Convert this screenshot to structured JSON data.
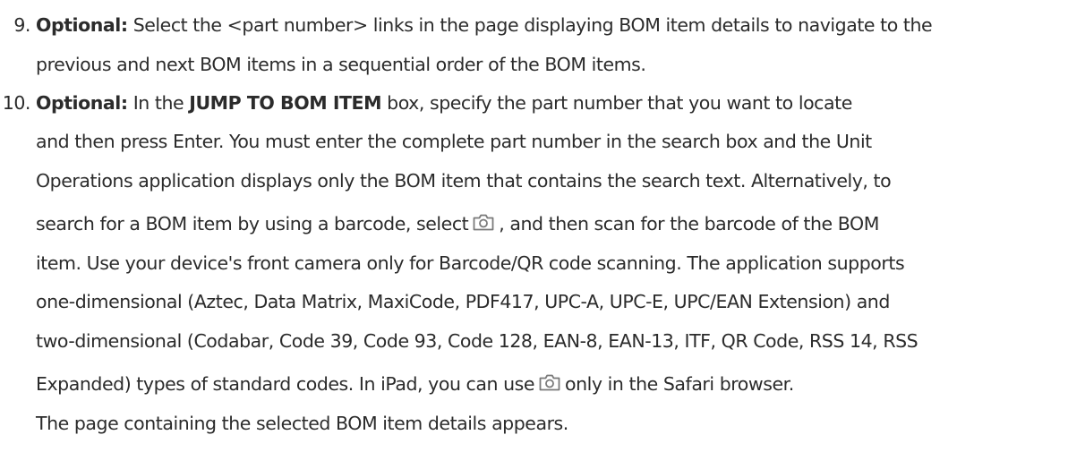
{
  "steps": [
    {
      "number": "9.",
      "label": "Optional:",
      "lines": [
        " Select the <part number> links in the page displaying BOM item details to navigate to the",
        "previous and next BOM items in a sequential order of the BOM items."
      ]
    },
    {
      "number": "10.",
      "label": "Optional:",
      "line1_a": " In the ",
      "line1_bold": "JUMP TO BOM ITEM",
      "line1_b": " box, specify the part number that you want to locate",
      "line2": "and then press Enter. You must enter the complete part number in the search box and the Unit",
      "line3": "Operations application displays only the BOM item that contains the search text. Alternatively, to",
      "line4_a": "search for a BOM item by using a barcode, select",
      "line4_b": ", and then scan for the barcode of the BOM",
      "line5": "item. Use your device's front camera only for Barcode/QR code scanning. The application supports",
      "line6": "one-dimensional (Aztec, Data Matrix, MaxiCode, PDF417, UPC-A, UPC-E, UPC/EAN Extension) and",
      "line7": "two-dimensional (Codabar, Code 39, Code 93, Code 128, EAN-8, EAN-13, ITF, QR Code, RSS 14, RSS",
      "line8_a": "Expanded) types of standard codes. In iPad, you can use",
      "line8_b": "only in the Safari browser.",
      "result": "The page containing the selected BOM item details appears."
    }
  ],
  "icons": {
    "camera": "camera-icon",
    "camera_color": "#7a7a7a"
  },
  "colors": {
    "text": "#2b2b2b"
  }
}
